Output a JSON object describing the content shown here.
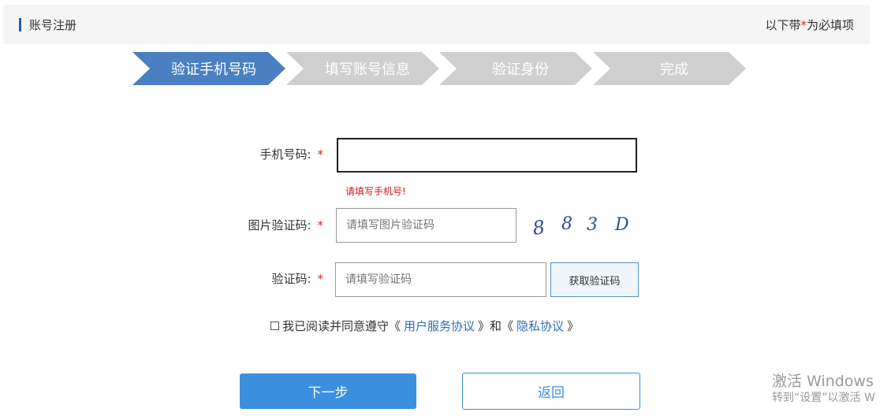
{
  "header": {
    "title": "账号注册",
    "note_prefix": "以下带",
    "note_star": "*",
    "note_suffix": "为必填项"
  },
  "steps": [
    {
      "label": "验证手机号码",
      "active": true
    },
    {
      "label": "填写账号信息",
      "active": false
    },
    {
      "label": "验证身份",
      "active": false
    },
    {
      "label": "完成",
      "active": false
    }
  ],
  "form": {
    "phone": {
      "label": "手机号码:",
      "required_mark": "*",
      "value": "",
      "placeholder": "",
      "error": "请填写手机号!"
    },
    "image_code": {
      "label": "图片验证码:",
      "required_mark": "*",
      "value": "",
      "placeholder": "请填写图片验证码",
      "captcha_text": "8 8 3 D"
    },
    "sms_code": {
      "label": "验证码:",
      "required_mark": "*",
      "value": "",
      "placeholder": "请填写验证码",
      "get_code_label": "获取验证码"
    },
    "agreement": {
      "checked": false,
      "prefix": "我已阅读并同意遵守《",
      "link1": "用户服务协议",
      "mid": "》和《",
      "link2": "隐私协议",
      "suffix": "》"
    }
  },
  "buttons": {
    "next": "下一步",
    "back": "返回"
  },
  "watermark": {
    "line1": "激活 Windows",
    "line2": "转到“设置”以激活 W"
  },
  "colors": {
    "accent": "#3a8fde",
    "step_active": "#4a7fc1",
    "step_inactive": "#cfcfcf",
    "error": "#d9141a"
  }
}
